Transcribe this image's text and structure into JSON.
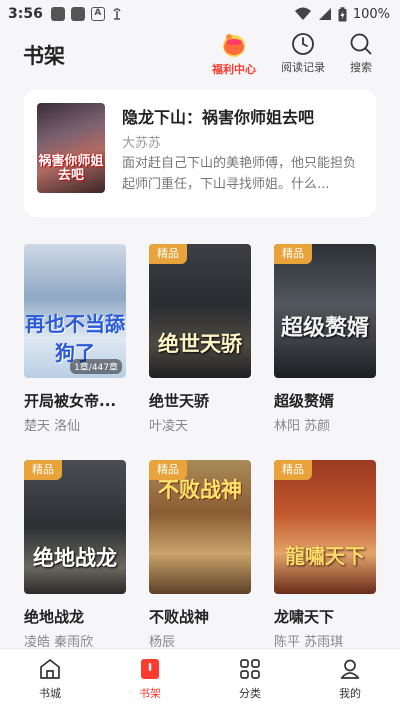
{
  "status_bar": {
    "time": "3:56",
    "battery": "100%"
  },
  "header": {
    "title": "书架",
    "welfare_label": "福利中心",
    "history_label": "阅读记录",
    "search_label": "搜索"
  },
  "recent": {
    "title": "隐龙下山：祸害你师姐去吧",
    "author": "大苏苏",
    "description": "面对赶自己下山的美艳师傅，他只能担负起师门重任，下山寻找师姐。什么...",
    "cover_text": "祸害你师姐去吧"
  },
  "books": [
    {
      "title": "开局被女帝...",
      "characters": "楚天  洛仙",
      "badge": "",
      "progress": "1章/447章",
      "cover_text": "再也不当舔狗了"
    },
    {
      "title": "绝世天骄",
      "characters": "叶凌天",
      "badge": "精品",
      "progress": "",
      "cover_text": "绝世天骄"
    },
    {
      "title": "超级赘婿",
      "characters": "林阳  苏颜",
      "badge": "精品",
      "progress": "",
      "cover_text": "超级赘婿"
    },
    {
      "title": "绝地战龙",
      "characters": "凌皓  秦雨欣",
      "badge": "精品",
      "progress": "",
      "cover_text": "绝地战龙"
    },
    {
      "title": "不败战神",
      "characters": "杨辰",
      "badge": "精品",
      "progress": "",
      "cover_text": "不败战神"
    },
    {
      "title": "龙啸天下",
      "characters": "陈平  苏雨琪",
      "badge": "精品",
      "progress": "",
      "cover_text": "龍嘯天下"
    }
  ],
  "bottom_nav": [
    {
      "label": "书城",
      "icon": "bookstore-icon"
    },
    {
      "label": "书架",
      "icon": "bookshelf-icon",
      "active": true
    },
    {
      "label": "分类",
      "icon": "category-icon"
    },
    {
      "label": "我的",
      "icon": "profile-icon"
    }
  ],
  "colors": {
    "accent": "#ff3b30",
    "badge": "#e8a33a"
  }
}
